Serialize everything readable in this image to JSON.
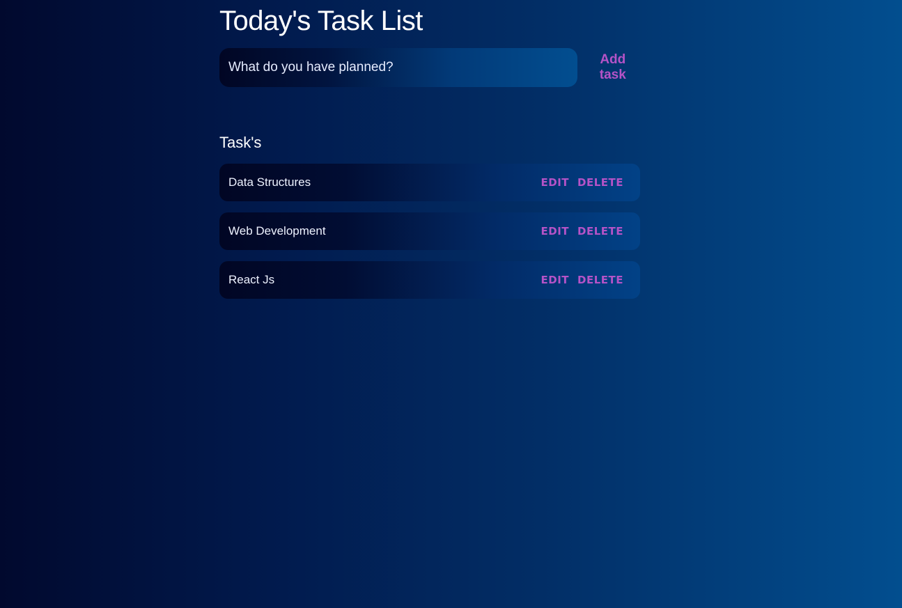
{
  "header": {
    "title": "Today's Task List"
  },
  "add_form": {
    "placeholder": "What do you have planned?",
    "value": "",
    "button_label": "Add task"
  },
  "tasks_section": {
    "heading": "Task's",
    "tasks": [
      {
        "name": "Data Structures",
        "edit_label": "EDIT",
        "delete_label": "DELETE"
      },
      {
        "name": "Web Development",
        "edit_label": "EDIT",
        "delete_label": "DELETE"
      },
      {
        "name": "React Js",
        "edit_label": "EDIT",
        "delete_label": "DELETE"
      }
    ]
  },
  "colors": {
    "accent": "#b553c7",
    "text": "#ffffff"
  }
}
